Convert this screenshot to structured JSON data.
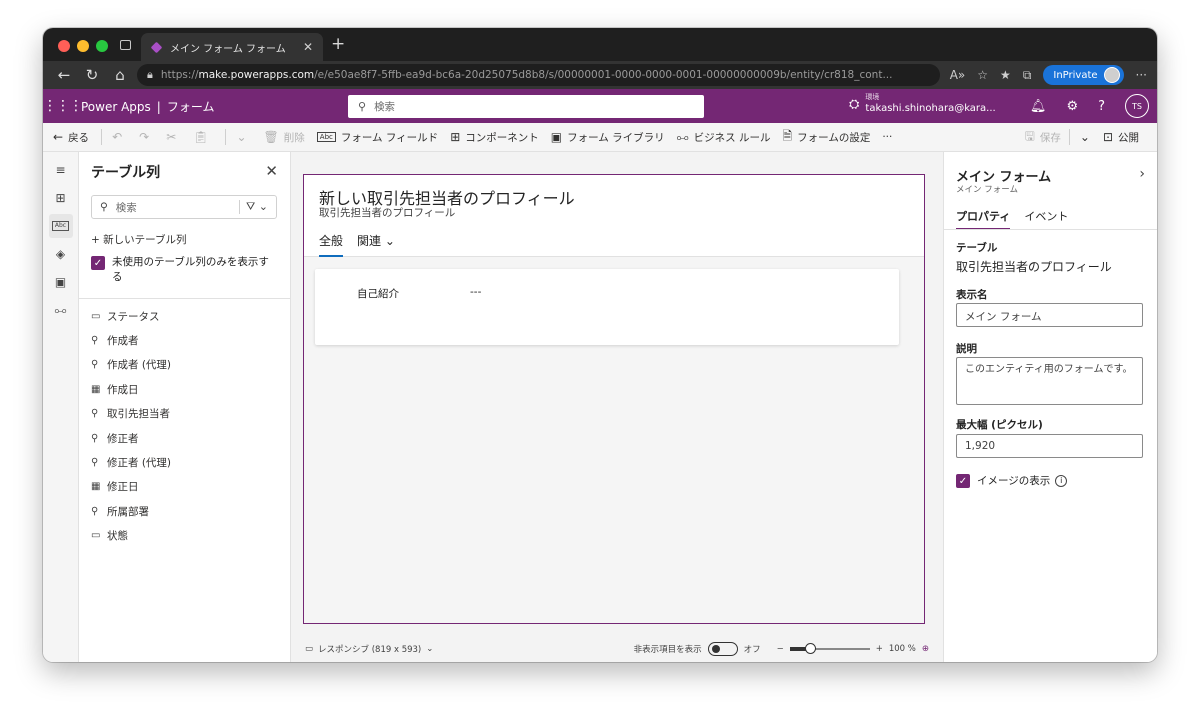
{
  "browser": {
    "tab_title": "メイン フォーム フォーム",
    "url_scheme": "https://",
    "url_host": "make.powerapps.com",
    "url_path": "/e/e50ae8f7-5ffb-ea9d-bc6a-20d25075d8b8/s/00000001-0000-0000-0001-00000000009b/entity/cr818_cont...",
    "inprivate_label": "InPrivate"
  },
  "app": {
    "name": "Power Apps",
    "section": "フォーム",
    "search_placeholder": "検索",
    "env_label": "環境",
    "env_name": "takashi.shinohara@kara...",
    "avatar_initials": "TS"
  },
  "commands": {
    "back": "戻る",
    "delete": "削除",
    "form_fields": "フォーム フィールド",
    "components": "コンポーネント",
    "form_library": "フォーム ライブラリ",
    "business_rules": "ビジネス ルール",
    "form_settings": "フォームの設定",
    "more": "···",
    "save": "保存",
    "publish": "公開"
  },
  "fields_panel": {
    "title": "テーブル列",
    "search_placeholder": "検索",
    "new_column": "+ 新しいテーブル列",
    "show_unused_label": "未使用のテーブル列のみを表示する",
    "items": [
      {
        "label": "ステータス",
        "icon": "option-set-icon",
        "glyph": "▭"
      },
      {
        "label": "作成者",
        "icon": "lookup-icon",
        "glyph": "⚲"
      },
      {
        "label": "作成者 (代理)",
        "icon": "lookup-icon",
        "glyph": "⚲"
      },
      {
        "label": "作成日",
        "icon": "calendar-icon",
        "glyph": "▦"
      },
      {
        "label": "取引先担当者",
        "icon": "lookup-icon",
        "glyph": "⚲"
      },
      {
        "label": "修正者",
        "icon": "lookup-icon",
        "glyph": "⚲"
      },
      {
        "label": "修正者 (代理)",
        "icon": "lookup-icon",
        "glyph": "⚲"
      },
      {
        "label": "修正日",
        "icon": "calendar-icon",
        "glyph": "▦"
      },
      {
        "label": "所属部署",
        "icon": "lookup-icon",
        "glyph": "⚲"
      },
      {
        "label": "状態",
        "icon": "option-set-icon",
        "glyph": "▭"
      }
    ]
  },
  "form": {
    "title": "新しい取引先担当者のプロフィール",
    "subtitle": "取引先担当者のプロフィール",
    "tabs": [
      "全般",
      "関連"
    ],
    "field_label": "自己紹介",
    "field_value": "---"
  },
  "statusbar": {
    "responsive_label": "レスポンシブ (819 x 593)",
    "hidden_items_label": "非表示項目を表示",
    "toggle_state": "オフ",
    "zoom_text": "100 %",
    "zoom_percent": 100
  },
  "properties": {
    "title": "メイン フォーム",
    "subtitle": "メイン フォーム",
    "tab_properties": "プロパティ",
    "tab_events": "イベント",
    "table_label": "テーブル",
    "table_value": "取引先担当者のプロフィール",
    "display_name_label": "表示名",
    "display_name_value": "メイン フォーム",
    "description_label": "説明",
    "description_value": "このエンティティ用のフォームです。",
    "max_width_label": "最大幅 (ピクセル)",
    "max_width_value": "1,920",
    "show_image_label": "イメージの表示"
  },
  "colors": {
    "brand_purple": "#742774",
    "tab_underline": "#0f6cbd",
    "inprivate_blue": "#1a73d9"
  }
}
